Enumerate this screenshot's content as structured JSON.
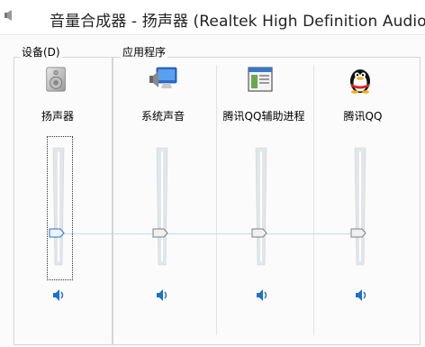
{
  "window": {
    "title": "音量合成器 - 扬声器 (Realtek High Definition Audio)"
  },
  "device_group": {
    "label": "设备(D)",
    "device": {
      "name": "扬声器",
      "icon": "speaker-icon",
      "volume_percent": 25
    }
  },
  "apps_group": {
    "label": "应用程序",
    "apps": [
      {
        "name": "系统声音",
        "icon": "system-sounds-icon",
        "volume_percent": 25
      },
      {
        "name": "腾讯QQ辅助进程",
        "icon": "app-window-icon",
        "volume_percent": 25
      },
      {
        "name": "腾讯QQ",
        "icon": "qq-penguin-icon",
        "volume_percent": 25
      }
    ]
  },
  "colors": {
    "accent": "#1e6fc8",
    "link_line": "#c8d8e6"
  }
}
